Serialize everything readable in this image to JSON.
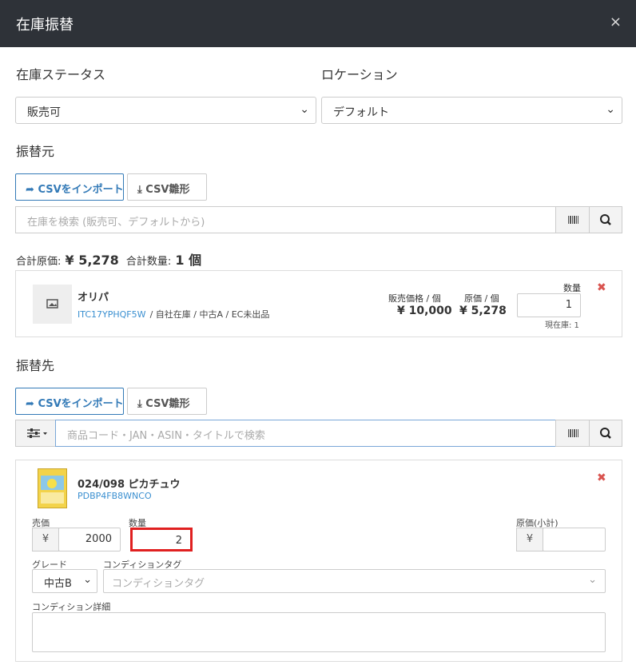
{
  "modal": {
    "title": "在庫振替",
    "close": "×"
  },
  "filters": {
    "status_label": "在庫ステータス",
    "status_value": "販売可",
    "location_label": "ロケーション",
    "location_value": "デフォルト"
  },
  "source": {
    "heading": "振替元",
    "import_btn": "CSVをインポート",
    "template_btn": "CSV雛形",
    "search_placeholder": "在庫を検索 (販売可、デフォルトから)",
    "totals": {
      "cost_label": "合計原価:",
      "cost_value": "¥ 5,278",
      "qty_label": "合計数量:",
      "qty_value": "1 個"
    },
    "item": {
      "name": "オリパ",
      "code": "ITC17YPHQF5W",
      "meta": "/ 自社在庫 / 中古A / EC未出品",
      "sale_price_label": "販売価格 / 個",
      "sale_price": "¥ 10,000",
      "cost_label": "原価 / 個",
      "cost": "¥ 5,278",
      "qty_label": "数量",
      "qty": "1",
      "stock_label": "現在庫: 1"
    }
  },
  "destination": {
    "heading": "振替先",
    "import_btn": "CSVをインポート",
    "template_btn": "CSV雛形",
    "search_placeholder": "商品コード・JAN・ASIN・タイトルで検索",
    "item": {
      "name": "024/098 ピカチュウ",
      "code": "PDBP4FB8WNCO",
      "price_label": "売価",
      "yen": "¥",
      "price": "2000",
      "qty_label": "数量",
      "qty": "2",
      "cost_label": "原価(小計)",
      "grade_label": "グレード",
      "grade_value": "中古B",
      "condition_tag_label": "コンディションタグ",
      "condition_tag_placeholder": "コンディションタグ",
      "condition_detail_label": "コンディション詳細"
    }
  },
  "colors": {
    "header_bg": "#2e3238",
    "primary": "#337ab7",
    "link": "#3a8fd0",
    "remove": "#d9534f",
    "highlight": "#e02020"
  }
}
